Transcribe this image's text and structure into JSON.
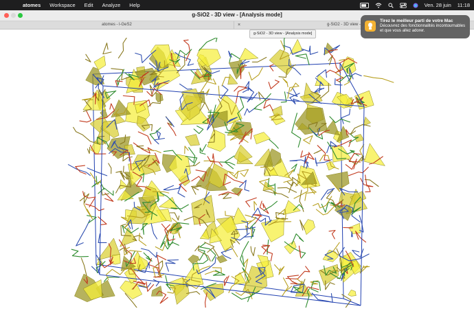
{
  "menubar": {
    "app_name": "atomes",
    "items": [
      "Workspace",
      "Edit",
      "Analyze",
      "Help"
    ],
    "battery_icon": "battery-icon",
    "wifi_icon": "wifi-icon",
    "control_center_icon": "control-center-icon",
    "search_icon": "spotlight-search-icon",
    "siri_icon": "siri-icon",
    "date": "Ven. 28 juin",
    "time": "11:18"
  },
  "window": {
    "title": "g-SiO2 - 3D view - [Analysis mode]",
    "traffic_lights": {
      "close": "#ff5f57",
      "minimize": "#d9d9d9",
      "zoom": "#2ac840"
    }
  },
  "tabs": [
    {
      "label": "atomes - l-GeS2",
      "active": false
    },
    {
      "label": "g-SiO2 - 3D view - [Analysis mode]",
      "active": true
    }
  ],
  "tooltip": "g-SiO2 - 3D view - [Analysis mode]",
  "notification": {
    "title": "Tirez le meilleur parti de votre Mac",
    "body": "Découvrez des fonctionnalités incontournables et que vous allez adorer.",
    "icon": "tips-lightbulb-icon"
  },
  "scene": {
    "background": "#ffffff",
    "box_color": "#1f3fb0",
    "polyhedra_color": "#f5ef3a",
    "bond_colors": [
      "#b8a020",
      "#c23a1e",
      "#2e8b2e",
      "#2f4fb0",
      "#8a7a20"
    ]
  }
}
